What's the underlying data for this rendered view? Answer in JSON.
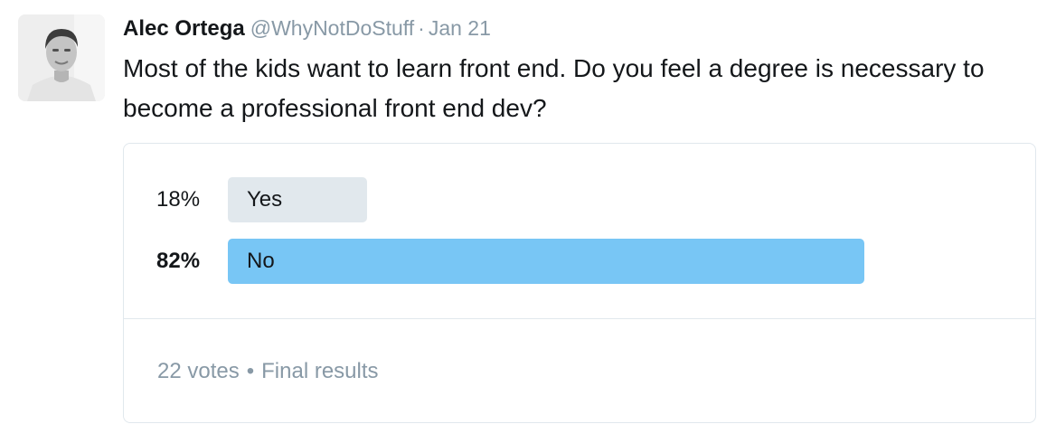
{
  "tweet": {
    "author_name": "Alec Ortega",
    "handle": "@WhyNotDoStuff",
    "separator": "·",
    "date": "Jan 21",
    "text": "Most of the kids want to learn front end. Do you feel a degree is necessary to become a professional front end dev?"
  },
  "poll": {
    "options": [
      {
        "label": "Yes",
        "percent_label": "18%",
        "share": 0.18,
        "winner": false
      },
      {
        "label": "No",
        "percent_label": "82%",
        "share": 0.82,
        "winner": true
      }
    ],
    "votes": "22 votes",
    "separator": "•",
    "status": "Final results"
  },
  "colors": {
    "winner_bar": "#78c6f5",
    "other_bar": "#e1e8ed",
    "muted_text": "#8899a6",
    "card_border": "#e1e8ed"
  }
}
